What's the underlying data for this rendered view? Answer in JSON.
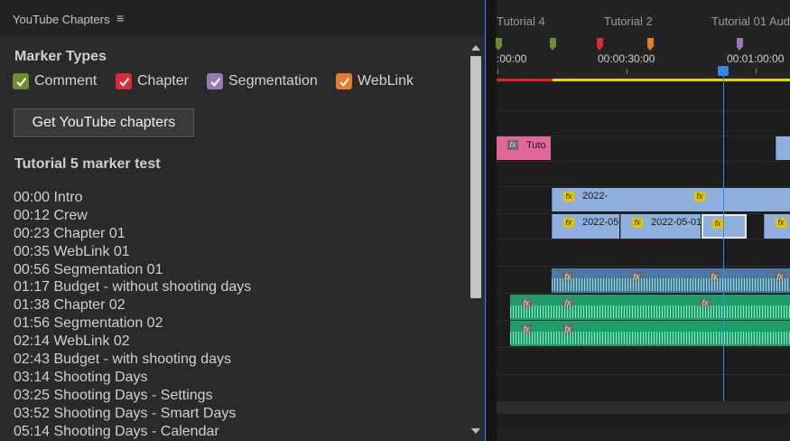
{
  "panel": {
    "title": "YouTube Chapters",
    "menu_icon": "hamburger-menu-icon",
    "marker_types_heading": "Marker Types",
    "marker_types": [
      {
        "label": "Comment",
        "color": "#6e8e2e",
        "checked": true
      },
      {
        "label": "Chapter",
        "color": "#d92c3a",
        "checked": true
      },
      {
        "label": "Segmentation",
        "color": "#9b78b4",
        "checked": true
      },
      {
        "label": "WebLink",
        "color": "#e87a2a",
        "checked": true
      }
    ],
    "get_button_label": "Get YouTube chapters",
    "result_title": "Tutorial 5 marker test",
    "chapters": [
      "00:00 Intro",
      "00:12 Crew",
      "00:23 Chapter 01",
      "00:35 WebLink 01",
      "00:56 Segmentation 01",
      "01:17 Budget - without shooting days",
      "01:38 Chapter 02",
      "01:56 Segmentation 02",
      "02:14 WebLink 02",
      "02:43 Budget - with shooting days",
      "03:14 Shooting Days",
      "03:25 Shooting Days - Settings",
      "03:52 Shooting Days - Smart Days",
      "05:14 Shooting Days - Calendar"
    ]
  },
  "timeline": {
    "marker_names": [
      "Tutorial 4",
      "Tutorial 2",
      "Tutorial 01 Aud"
    ],
    "timecodes": [
      ":00:00",
      "00:00:30:00",
      "00:01:00:00"
    ],
    "clip_labels": {
      "pink": "Tuto",
      "video1": "2022-",
      "video2a": "2022-05",
      "video2b": "2022-05-01"
    },
    "fx_label": "fx",
    "accent_color": "#2d8ceb"
  }
}
